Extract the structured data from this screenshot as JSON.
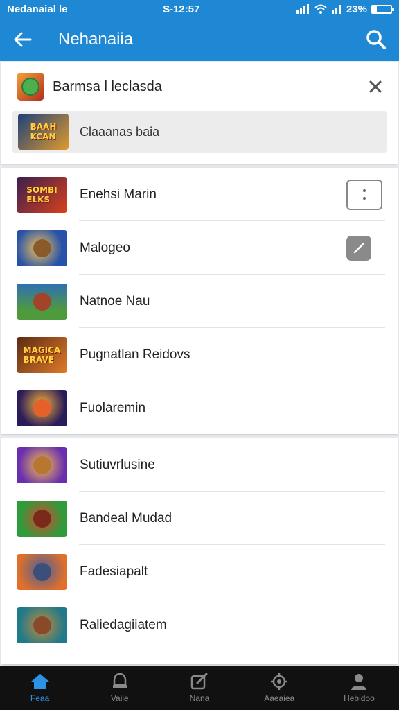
{
  "status_bar": {
    "left": "Nedanaial le",
    "time": "S-12:57",
    "battery": "23%",
    "battery_fraction": 0.23
  },
  "app_bar": {
    "title": "Nehanaiia",
    "back_icon": "arrow-left-icon",
    "search_icon": "search-icon"
  },
  "top_card": {
    "header_label": "Barmsa l leclasda",
    "sub_item_label": "Claaanas baia"
  },
  "list_a": [
    {
      "label": "Enehsi Marin",
      "action": "more"
    },
    {
      "label": "Malogeo",
      "action": "edit"
    },
    {
      "label": "Natnoe Nau"
    },
    {
      "label": "Pugnatlan Reidovs"
    },
    {
      "label": "Fuolaremin"
    }
  ],
  "list_b": [
    {
      "label": "Sutiuvrlusine"
    },
    {
      "label": "Bandeal Mudad"
    },
    {
      "label": "Fadesiapalt"
    },
    {
      "label": "Raliedagiiatem"
    }
  ],
  "bottom_nav": [
    {
      "label": "Feaa",
      "icon": "home-icon",
      "active": true
    },
    {
      "label": "Vaiie",
      "icon": "alert-icon",
      "active": false
    },
    {
      "label": "Nana",
      "icon": "edit-square-icon",
      "active": false
    },
    {
      "label": "Aaeaiea",
      "icon": "settings-icon",
      "active": false
    },
    {
      "label": "Hebidoo",
      "icon": "profile-icon",
      "active": false
    }
  ],
  "colors": {
    "accent": "#1e88d4",
    "nav_active": "#2b93e6",
    "nav_bg": "#111111"
  }
}
